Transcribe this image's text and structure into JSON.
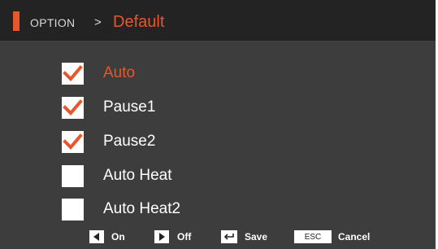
{
  "header": {
    "parent": "OPTION",
    "separator": ">",
    "current": "Default",
    "accent_color": "#e8562b"
  },
  "options": [
    {
      "label": "Auto",
      "checked": true,
      "selected": true
    },
    {
      "label": "Pause1",
      "checked": true,
      "selected": false
    },
    {
      "label": "Pause2",
      "checked": true,
      "selected": false
    },
    {
      "label": "Auto Heat",
      "checked": false,
      "selected": false
    },
    {
      "label": "Auto Heat2",
      "checked": false,
      "selected": false
    }
  ],
  "footer": {
    "on": {
      "icon": "left-arrow-key-icon",
      "label": "On"
    },
    "off": {
      "icon": "right-arrow-key-icon",
      "label": "Off"
    },
    "save": {
      "icon": "enter-key-icon",
      "label": "Save"
    },
    "cancel": {
      "key": "ESC",
      "label": "Cancel"
    }
  },
  "colors": {
    "background": "#3d3d3d",
    "header_bg": "#232323",
    "accent": "#e8562b",
    "text": "#ffffff"
  }
}
